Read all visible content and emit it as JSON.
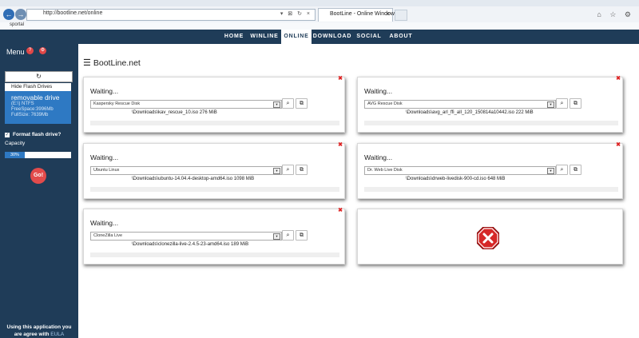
{
  "browser": {
    "url": "http://bootline.net/online",
    "tab_title": "BootLine - Online Windows...",
    "back_glyph": "←",
    "forward_glyph": "→",
    "tab_close": "×",
    "url_tools": "▾ ⊠ ↻ ×",
    "tools": "⌂ ☆ ⚙",
    "favorites": "sportal"
  },
  "topnav": {
    "items": [
      "HOME",
      "WINLINE",
      "ONLINE",
      "DOWNLOAD",
      "SOCIAL",
      "ABOUT"
    ],
    "active": "ONLINE"
  },
  "sidebar": {
    "menu_label": "Menu",
    "help_glyph": "?",
    "settings_glyph": "⚙",
    "refresh_glyph": "↻",
    "hide_flash_label": "Hide Flash Drives",
    "drive": {
      "name": "removable drive",
      "letter": "(E:\\) NTFS",
      "free_space": "FreeSpace:3996Mb",
      "full_size": "FullSize: 7639Mb"
    },
    "format_checked_glyph": "✓",
    "format_label": "Format flash drive?",
    "capacity_label": "Capacity",
    "capacity_percent": 30,
    "capacity_text": "30%",
    "go_label": "Go!",
    "agree_text": "Using this application you are agree with",
    "eula_label": "EULA"
  },
  "main": {
    "brand": "BootLine.net",
    "hamburger_glyph": "☰",
    "close_glyph": "✖",
    "select_arrow": "▾",
    "search_glyph": "⌕",
    "open_glyph": "⧉",
    "cards": [
      {
        "status": "Waiting...",
        "selected": "Kaspersky Rescue Disk",
        "path": "\\Downloads\\kav_rescue_10.iso 276 MiB"
      },
      {
        "status": "Waiting...",
        "selected": "AVG Rescue Disk",
        "path": "\\Downloads\\avg_arl_ffi_all_120_150814a10442.iso 222 MiB"
      },
      {
        "status": "Waiting...",
        "selected": "Ubuntu Linux",
        "path": "\\Downloads\\ubuntu-14.04.4-desktop-amd64.iso 1098 MiB"
      },
      {
        "status": "Waiting...",
        "selected": "Dr. Web Live Disk",
        "path": "\\Downloads\\drweb-livedisk-900-cd.iso 648 MiB"
      },
      {
        "status": "Waiting...",
        "selected": "CloneZilla Live",
        "path": "\\Downloads\\clonezilla-live-2.4.5-23-amd64.iso 189 MiB"
      }
    ]
  },
  "colors": {
    "navy": "#1f3c58",
    "accent_blue": "#2e79c3",
    "red": "#e24b4b"
  }
}
